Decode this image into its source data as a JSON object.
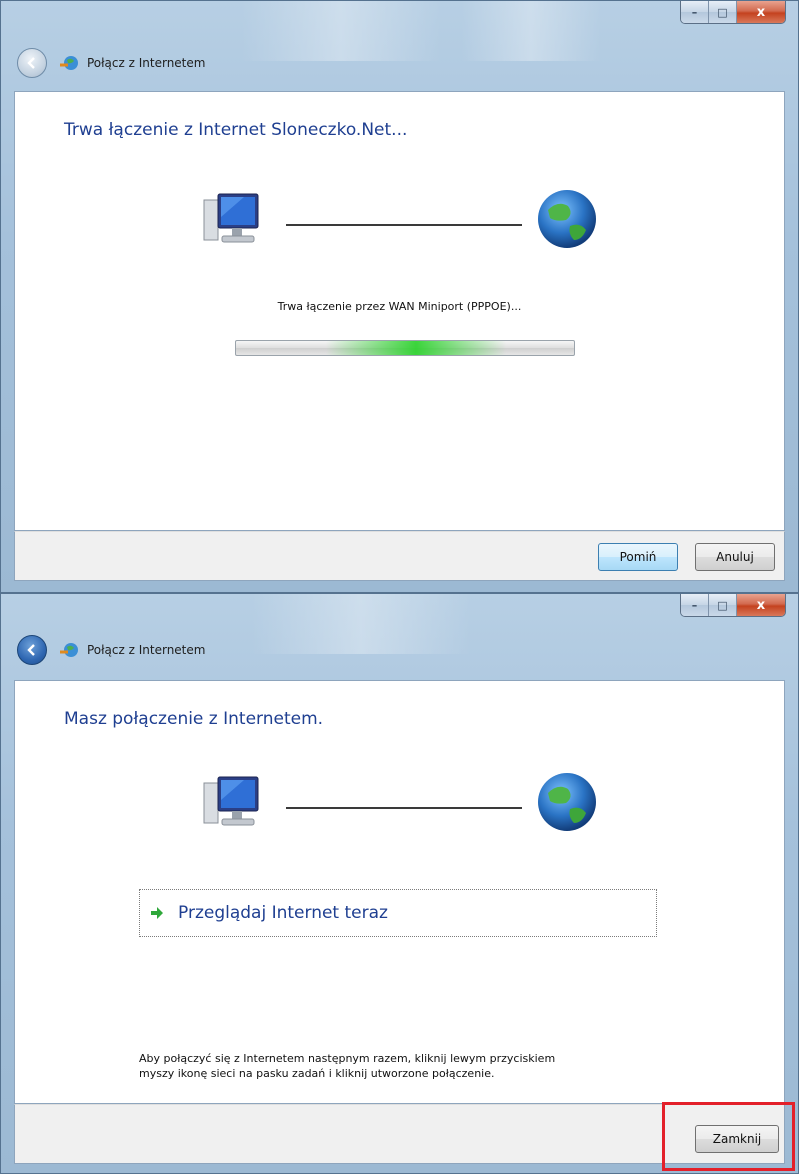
{
  "window_connecting": {
    "title": "Połącz z Internetem",
    "heading": "Trwa łączenie z Internet Sloneczko.Net...",
    "status": "Trwa łączenie przez WAN Miniport (PPPOE)...",
    "progress_state": "indeterminate",
    "buttons": {
      "skip": "Pomiń",
      "cancel": "Anuluj"
    }
  },
  "window_connected": {
    "title": "Połącz z Internetem",
    "heading": "Masz połączenie z Internetem.",
    "link_label": "Przeglądaj Internet teraz",
    "note": "Aby połączyć się z Internetem następnym razem, kliknij lewym przyciskiem myszy ikonę sieci na pasku zadań i kliknij utworzone połączenie.",
    "buttons": {
      "close": "Zamknij"
    }
  },
  "caption_buttons": {
    "minimize": "–",
    "maximize": "□",
    "close": "x"
  },
  "icons": {
    "back": "back-arrow-icon",
    "app": "network-connection-icon",
    "computer": "computer-icon",
    "globe": "globe-icon",
    "link_arrow": "green-arrow-icon"
  },
  "colors": {
    "heading": "#1f3f91",
    "highlight": "#e3202a",
    "progress": "#28d228"
  }
}
